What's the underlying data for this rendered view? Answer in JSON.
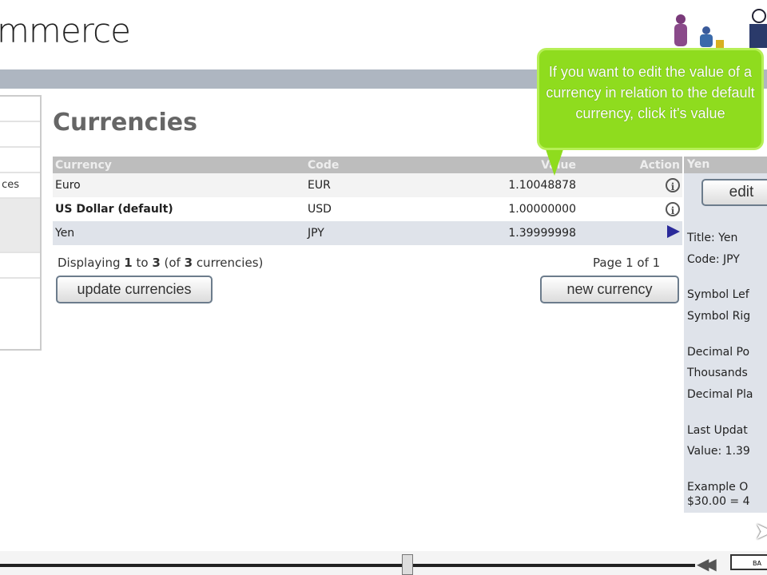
{
  "header": {
    "logo": "mmerce"
  },
  "sidebar": {
    "items": [
      "",
      "",
      "",
      "ces",
      "",
      "",
      ""
    ]
  },
  "main": {
    "title": "Currencies",
    "columns": [
      "Currency",
      "Code",
      "Value",
      "Action"
    ],
    "rows": [
      {
        "name": "Euro",
        "code": "EUR",
        "value": "1.10048878",
        "action": "info-icon"
      },
      {
        "name": "US Dollar (default)",
        "code": "USD",
        "value": "1.00000000",
        "action": "info-icon"
      },
      {
        "name": "Yen",
        "code": "JPY",
        "value": "1.39999998",
        "action": "selected-arrow-icon"
      }
    ],
    "displaying_prefix": "Displaying ",
    "from": "1",
    "to_word": " to ",
    "to": "3",
    "of_prefix": " (of ",
    "total": "3",
    "of_suffix": " currencies)",
    "page": "Page 1 of 1",
    "update_button": "update currencies",
    "new_button": "new currency"
  },
  "panel": {
    "heading": "Yen",
    "edit_button": "edit",
    "lines": [
      "Title: Yen",
      "Code: JPY",
      "Symbol Lef",
      "Symbol Rig",
      "Decimal Po",
      "Thousands",
      "Decimal Pla",
      "Last Updat",
      "Value: 1.39",
      "Example O",
      "$30.00 = 4"
    ]
  },
  "tooltip": {
    "text": "If you want to edit the value of a currency in relation to the default currency, click it's value"
  },
  "player": {
    "progress": 0.53,
    "box_label": "BA"
  }
}
